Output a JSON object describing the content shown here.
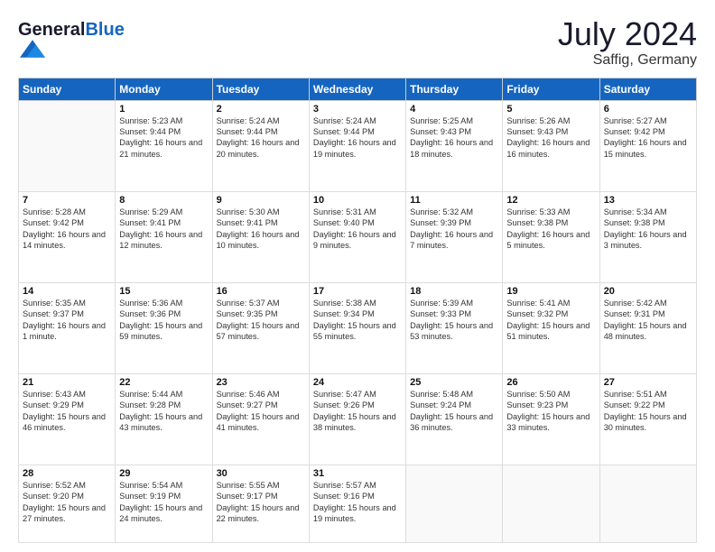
{
  "header": {
    "logo_text_general": "General",
    "logo_text_blue": "Blue",
    "main_title": "July 2024",
    "subtitle": "Saffig, Germany"
  },
  "days_of_week": [
    "Sunday",
    "Monday",
    "Tuesday",
    "Wednesday",
    "Thursday",
    "Friday",
    "Saturday"
  ],
  "weeks": [
    [
      {
        "date": "",
        "sunrise": "",
        "sunset": "",
        "daylight": ""
      },
      {
        "date": "1",
        "sunrise": "Sunrise: 5:23 AM",
        "sunset": "Sunset: 9:44 PM",
        "daylight": "Daylight: 16 hours and 21 minutes."
      },
      {
        "date": "2",
        "sunrise": "Sunrise: 5:24 AM",
        "sunset": "Sunset: 9:44 PM",
        "daylight": "Daylight: 16 hours and 20 minutes."
      },
      {
        "date": "3",
        "sunrise": "Sunrise: 5:24 AM",
        "sunset": "Sunset: 9:44 PM",
        "daylight": "Daylight: 16 hours and 19 minutes."
      },
      {
        "date": "4",
        "sunrise": "Sunrise: 5:25 AM",
        "sunset": "Sunset: 9:43 PM",
        "daylight": "Daylight: 16 hours and 18 minutes."
      },
      {
        "date": "5",
        "sunrise": "Sunrise: 5:26 AM",
        "sunset": "Sunset: 9:43 PM",
        "daylight": "Daylight: 16 hours and 16 minutes."
      },
      {
        "date": "6",
        "sunrise": "Sunrise: 5:27 AM",
        "sunset": "Sunset: 9:42 PM",
        "daylight": "Daylight: 16 hours and 15 minutes."
      }
    ],
    [
      {
        "date": "7",
        "sunrise": "Sunrise: 5:28 AM",
        "sunset": "Sunset: 9:42 PM",
        "daylight": "Daylight: 16 hours and 14 minutes."
      },
      {
        "date": "8",
        "sunrise": "Sunrise: 5:29 AM",
        "sunset": "Sunset: 9:41 PM",
        "daylight": "Daylight: 16 hours and 12 minutes."
      },
      {
        "date": "9",
        "sunrise": "Sunrise: 5:30 AM",
        "sunset": "Sunset: 9:41 PM",
        "daylight": "Daylight: 16 hours and 10 minutes."
      },
      {
        "date": "10",
        "sunrise": "Sunrise: 5:31 AM",
        "sunset": "Sunset: 9:40 PM",
        "daylight": "Daylight: 16 hours and 9 minutes."
      },
      {
        "date": "11",
        "sunrise": "Sunrise: 5:32 AM",
        "sunset": "Sunset: 9:39 PM",
        "daylight": "Daylight: 16 hours and 7 minutes."
      },
      {
        "date": "12",
        "sunrise": "Sunrise: 5:33 AM",
        "sunset": "Sunset: 9:38 PM",
        "daylight": "Daylight: 16 hours and 5 minutes."
      },
      {
        "date": "13",
        "sunrise": "Sunrise: 5:34 AM",
        "sunset": "Sunset: 9:38 PM",
        "daylight": "Daylight: 16 hours and 3 minutes."
      }
    ],
    [
      {
        "date": "14",
        "sunrise": "Sunrise: 5:35 AM",
        "sunset": "Sunset: 9:37 PM",
        "daylight": "Daylight: 16 hours and 1 minute."
      },
      {
        "date": "15",
        "sunrise": "Sunrise: 5:36 AM",
        "sunset": "Sunset: 9:36 PM",
        "daylight": "Daylight: 15 hours and 59 minutes."
      },
      {
        "date": "16",
        "sunrise": "Sunrise: 5:37 AM",
        "sunset": "Sunset: 9:35 PM",
        "daylight": "Daylight: 15 hours and 57 minutes."
      },
      {
        "date": "17",
        "sunrise": "Sunrise: 5:38 AM",
        "sunset": "Sunset: 9:34 PM",
        "daylight": "Daylight: 15 hours and 55 minutes."
      },
      {
        "date": "18",
        "sunrise": "Sunrise: 5:39 AM",
        "sunset": "Sunset: 9:33 PM",
        "daylight": "Daylight: 15 hours and 53 minutes."
      },
      {
        "date": "19",
        "sunrise": "Sunrise: 5:41 AM",
        "sunset": "Sunset: 9:32 PM",
        "daylight": "Daylight: 15 hours and 51 minutes."
      },
      {
        "date": "20",
        "sunrise": "Sunrise: 5:42 AM",
        "sunset": "Sunset: 9:31 PM",
        "daylight": "Daylight: 15 hours and 48 minutes."
      }
    ],
    [
      {
        "date": "21",
        "sunrise": "Sunrise: 5:43 AM",
        "sunset": "Sunset: 9:29 PM",
        "daylight": "Daylight: 15 hours and 46 minutes."
      },
      {
        "date": "22",
        "sunrise": "Sunrise: 5:44 AM",
        "sunset": "Sunset: 9:28 PM",
        "daylight": "Daylight: 15 hours and 43 minutes."
      },
      {
        "date": "23",
        "sunrise": "Sunrise: 5:46 AM",
        "sunset": "Sunset: 9:27 PM",
        "daylight": "Daylight: 15 hours and 41 minutes."
      },
      {
        "date": "24",
        "sunrise": "Sunrise: 5:47 AM",
        "sunset": "Sunset: 9:26 PM",
        "daylight": "Daylight: 15 hours and 38 minutes."
      },
      {
        "date": "25",
        "sunrise": "Sunrise: 5:48 AM",
        "sunset": "Sunset: 9:24 PM",
        "daylight": "Daylight: 15 hours and 36 minutes."
      },
      {
        "date": "26",
        "sunrise": "Sunrise: 5:50 AM",
        "sunset": "Sunset: 9:23 PM",
        "daylight": "Daylight: 15 hours and 33 minutes."
      },
      {
        "date": "27",
        "sunrise": "Sunrise: 5:51 AM",
        "sunset": "Sunset: 9:22 PM",
        "daylight": "Daylight: 15 hours and 30 minutes."
      }
    ],
    [
      {
        "date": "28",
        "sunrise": "Sunrise: 5:52 AM",
        "sunset": "Sunset: 9:20 PM",
        "daylight": "Daylight: 15 hours and 27 minutes."
      },
      {
        "date": "29",
        "sunrise": "Sunrise: 5:54 AM",
        "sunset": "Sunset: 9:19 PM",
        "daylight": "Daylight: 15 hours and 24 minutes."
      },
      {
        "date": "30",
        "sunrise": "Sunrise: 5:55 AM",
        "sunset": "Sunset: 9:17 PM",
        "daylight": "Daylight: 15 hours and 22 minutes."
      },
      {
        "date": "31",
        "sunrise": "Sunrise: 5:57 AM",
        "sunset": "Sunset: 9:16 PM",
        "daylight": "Daylight: 15 hours and 19 minutes."
      },
      {
        "date": "",
        "sunrise": "",
        "sunset": "",
        "daylight": ""
      },
      {
        "date": "",
        "sunrise": "",
        "sunset": "",
        "daylight": ""
      },
      {
        "date": "",
        "sunrise": "",
        "sunset": "",
        "daylight": ""
      }
    ]
  ]
}
